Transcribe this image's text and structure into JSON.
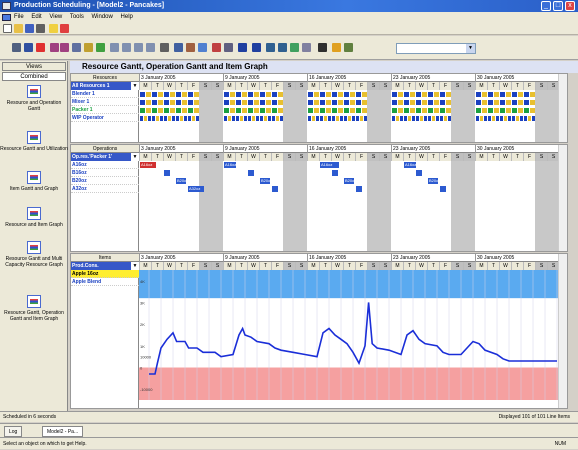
{
  "window": {
    "title": "Production Scheduling - [Model2 - Pancakes]",
    "min": "_",
    "max": "□",
    "close": "x"
  },
  "menu": [
    "File",
    "Edit",
    "View",
    "Tools",
    "Window",
    "Help"
  ],
  "left_panel": {
    "tabs": [
      "Views",
      "Combined"
    ],
    "items": [
      "Resource and Operation Gantt",
      "Resource Gantt and Utilization",
      "Item Gantt and Graph",
      "Resource and Item Graph",
      "Resource Gantt and Multi Capacity Resource Graph",
      "Resource Gantt, Operation Gantt and Item Graph"
    ]
  },
  "main_header": "Resource Gantt, Operation Gantt and Item Graph",
  "weeks": [
    "3 January 2005",
    "9 January 2005",
    "16 January 2005",
    "23 January 2005",
    "30 January 2005"
  ],
  "days": [
    "M",
    "T",
    "W",
    "T",
    "F",
    "S",
    "S"
  ],
  "resources": {
    "header": "Resources",
    "selector": "All Resources 1",
    "rows": [
      "Blender 1",
      "Mixer 1",
      "Packer 1",
      "WIP Operator"
    ],
    "row_colors": [
      "#1a40c0",
      "#1a40c0",
      "#1aa040",
      "#1a40c0"
    ]
  },
  "operations": {
    "header": "Operations",
    "selector": "Op.res.'Packer 1'",
    "rows": [
      "A16oz",
      "B16oz",
      "B20oz",
      "A32oz"
    ],
    "bars": [
      {
        "row": 0,
        "day": 0,
        "len": 1.3,
        "label": "A16oz",
        "color": "#d03030"
      },
      {
        "row": 0,
        "day": 7,
        "len": 1.0,
        "label": "A16oz",
        "color": "#2c5ad0"
      },
      {
        "row": 0,
        "day": 15,
        "len": 1.6,
        "label": "A16oz",
        "color": "#2c5ad0"
      },
      {
        "row": 0,
        "day": 22,
        "len": 1.0,
        "label": "A16oz",
        "color": "#2c5ad0"
      },
      {
        "row": 1,
        "day": 2,
        "len": 0.5,
        "label": "",
        "color": "#2c5ad0"
      },
      {
        "row": 1,
        "day": 9,
        "len": 0.5,
        "label": "",
        "color": "#2c5ad0"
      },
      {
        "row": 1,
        "day": 16,
        "len": 0.5,
        "label": "",
        "color": "#2c5ad0"
      },
      {
        "row": 1,
        "day": 23,
        "len": 0.5,
        "label": "",
        "color": "#2c5ad0"
      },
      {
        "row": 2,
        "day": 3,
        "len": 0.8,
        "label": "B20oz",
        "color": "#2c5ad0"
      },
      {
        "row": 2,
        "day": 10,
        "len": 0.8,
        "label": "B20oz",
        "color": "#2c5ad0"
      },
      {
        "row": 2,
        "day": 17,
        "len": 0.8,
        "label": "B20oz",
        "color": "#2c5ad0"
      },
      {
        "row": 2,
        "day": 24,
        "len": 0.8,
        "label": "B20oz",
        "color": "#2c5ad0"
      },
      {
        "row": 3,
        "day": 4,
        "len": 1.3,
        "label": "A32oz",
        "color": "#2c5ad0"
      },
      {
        "row": 3,
        "day": 11,
        "len": 0.5,
        "label": "",
        "color": "#2c5ad0"
      },
      {
        "row": 3,
        "day": 18,
        "len": 0.5,
        "label": "",
        "color": "#2c5ad0"
      },
      {
        "row": 3,
        "day": 25,
        "len": 0.5,
        "label": "",
        "color": "#2c5ad0"
      }
    ]
  },
  "items": {
    "header": "Items",
    "selector": "Prod.Cons.",
    "rows": [
      "Apple 16oz",
      "Apple Blend"
    ],
    "y_ticks": [
      "4K",
      "3K",
      "2K",
      "1K",
      "10000",
      "0",
      "-10000"
    ]
  },
  "chart_data": {
    "type": "line",
    "title": "",
    "xlabel": "",
    "ylabel": "",
    "x_unit": "day",
    "ylim": [
      -1500,
      4500
    ],
    "bands": {
      "upper_color": "#5aaaf0",
      "lower_color": "#f5a0a0"
    },
    "series": [
      {
        "color": "#1a2ed8",
        "points": [
          [
            0,
            -300
          ],
          [
            0.5,
            -300
          ],
          [
            0.7,
            200
          ],
          [
            1,
            900
          ],
          [
            1.5,
            1300
          ],
          [
            2,
            1600
          ],
          [
            2.3,
            1200
          ],
          [
            3,
            1200
          ],
          [
            3.3,
            900
          ],
          [
            4,
            900
          ],
          [
            4.5,
            700
          ],
          [
            5.5,
            700
          ],
          [
            6,
            500
          ],
          [
            7,
            600
          ],
          [
            7.5,
            1500
          ],
          [
            7.8,
            1800
          ],
          [
            8,
            1500
          ],
          [
            8.5,
            1400
          ],
          [
            9,
            1200
          ],
          [
            10,
            1100
          ],
          [
            10.5,
            900
          ],
          [
            11,
            800
          ],
          [
            12,
            700
          ],
          [
            13,
            600
          ],
          [
            14,
            500
          ],
          [
            14.5,
            1600
          ],
          [
            15,
            1800
          ],
          [
            15.5,
            1500
          ],
          [
            16,
            1300
          ],
          [
            16.5,
            1100
          ],
          [
            17,
            700
          ],
          [
            17.5,
            200
          ],
          [
            18,
            1000
          ],
          [
            18.3,
            3000
          ],
          [
            18.6,
            1100
          ],
          [
            19,
            900
          ],
          [
            20,
            800
          ],
          [
            21,
            600
          ],
          [
            21.5,
            1500
          ],
          [
            22,
            1700
          ],
          [
            22.5,
            1300
          ],
          [
            23,
            1100
          ],
          [
            24,
            1000
          ],
          [
            24.5,
            700
          ],
          [
            25,
            600
          ],
          [
            26,
            600
          ],
          [
            27,
            1200
          ],
          [
            27.5,
            1100
          ],
          [
            28,
            800
          ],
          [
            29,
            600
          ],
          [
            29.5,
            400
          ],
          [
            30,
            300
          ],
          [
            31,
            300
          ],
          [
            32,
            300
          ],
          [
            33,
            300
          ],
          [
            34,
            300
          ]
        ]
      }
    ]
  },
  "status": {
    "schedule": "Scheduled in 6 seconds",
    "displayed": "Displayed 101 of 101 Line Items"
  },
  "tabs": [
    "Log",
    "Model2 - Pa..."
  ],
  "help_text": "Select an object on which to get Help.",
  "num_indicator": "NUM"
}
